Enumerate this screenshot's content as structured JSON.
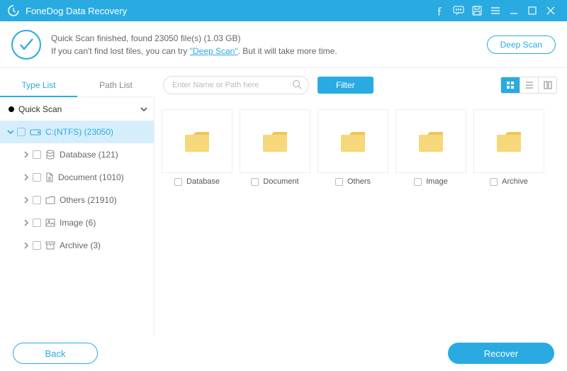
{
  "titlebar": {
    "title": "FoneDog Data Recovery"
  },
  "status": {
    "line1_a": "Quick Scan finished, found ",
    "file_count": "23050",
    "line1_b": " file(s) (",
    "size": "1.03 GB",
    "line1_c": ")",
    "line2_a": "If you can't find lost files, you can try ",
    "deep_scan_link": "\"Deep Scan\"",
    "line2_b": ". But it will take more time.",
    "deep_scan_btn": "Deep Scan"
  },
  "tabs": {
    "type_list": "Type List",
    "path_list": "Path List"
  },
  "search": {
    "placeholder": "Enter Name or Path here"
  },
  "filter_btn": "Filter",
  "tree": {
    "root": "Quick Scan",
    "drive": "C:(NTFS) (23050)",
    "cats": [
      {
        "label": "Database (121)"
      },
      {
        "label": "Document (1010)"
      },
      {
        "label": "Others (21910)"
      },
      {
        "label": "Image (6)"
      },
      {
        "label": "Archive (3)"
      }
    ]
  },
  "folders": [
    "Database",
    "Document",
    "Others",
    "Image",
    "Archive"
  ],
  "footer": {
    "back": "Back",
    "recover": "Recover"
  },
  "colors": {
    "accent": "#29abe2"
  }
}
